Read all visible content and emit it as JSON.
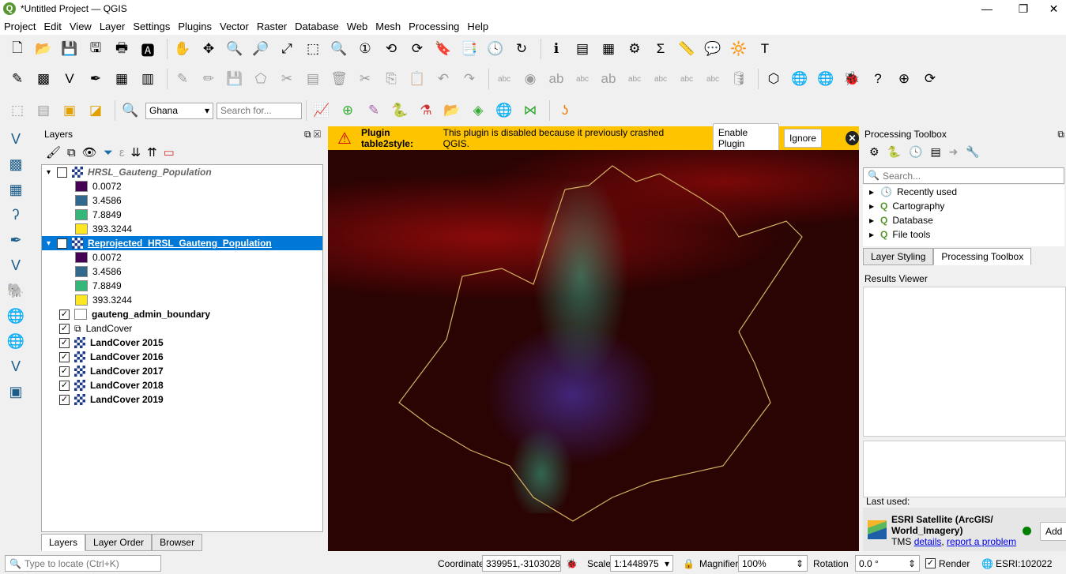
{
  "window": {
    "title": "*Untitled Project — QGIS",
    "minimize": "—",
    "maximize": "❐",
    "close": "✕"
  },
  "menu": [
    "Project",
    "Edit",
    "View",
    "Layer",
    "Settings",
    "Plugins",
    "Vector",
    "Raster",
    "Database",
    "Web",
    "Mesh",
    "Processing",
    "Help"
  ],
  "toolbar3": {
    "locator_value": "Ghana",
    "search_placeholder": "Search for..."
  },
  "layers_panel": {
    "title": "Layers",
    "layers": [
      {
        "name": "HRSL_Gauteng_Population",
        "checked": false,
        "italic": true,
        "legend": [
          {
            "label": "0.0072",
            "color": "#440154"
          },
          {
            "label": "3.4586",
            "color": "#31688e"
          },
          {
            "label": "7.8849",
            "color": "#35b779"
          },
          {
            "label": "393.3244",
            "color": "#fde725"
          }
        ]
      },
      {
        "name": "Reprojected_HRSL_Gauteng_Population",
        "checked": true,
        "selected": true,
        "legend": [
          {
            "label": "0.0072",
            "color": "#440154"
          },
          {
            "label": "3.4586",
            "color": "#31688e"
          },
          {
            "label": "7.8849",
            "color": "#35b779"
          },
          {
            "label": "393.3244",
            "color": "#fde725"
          }
        ]
      },
      {
        "name": "gauteng_admin_boundary",
        "checked": true,
        "bold": true
      },
      {
        "name": "LandCover",
        "checked": true,
        "group": true
      },
      {
        "name": "LandCover 2015",
        "checked": true,
        "bold": true
      },
      {
        "name": "LandCover 2016",
        "checked": true,
        "bold": true
      },
      {
        "name": "LandCover 2017",
        "checked": true,
        "bold": true
      },
      {
        "name": "LandCover 2018",
        "checked": true,
        "bold": true
      },
      {
        "name": "LandCover 2019",
        "checked": true,
        "bold": true
      }
    ],
    "tabs": [
      "Layers",
      "Layer Order",
      "Browser"
    ]
  },
  "message": {
    "title": "Plugin table2style:",
    "text": "This plugin is disabled because it previously crashed QGIS.",
    "enable": "Enable Plugin",
    "ignore": "Ignore"
  },
  "processing": {
    "title": "Processing Toolbox",
    "search_placeholder": "Search...",
    "items": [
      "Recently used",
      "Cartography",
      "Database",
      "File tools"
    ],
    "tabs": [
      "Layer Styling",
      "Processing Toolbox"
    ]
  },
  "results": {
    "title": "Results Viewer"
  },
  "qms": {
    "last_used": "Last used:",
    "service_name": "ESRI Satellite (ArcGIS/ World_Imagery)",
    "type": "TMS",
    "details": "details",
    "report": "report a problem",
    "add": "Add",
    "status_color": "#008000"
  },
  "status": {
    "locate_placeholder": "Type to locate (Ctrl+K)",
    "coordinate_label": "Coordinate",
    "coordinate": "339951,-3103028",
    "scale_label": "Scale",
    "scale": "1:1448975",
    "magnifier_label": "Magnifier",
    "magnifier": "100%",
    "rotation_label": "Rotation",
    "rotation": "0.0 °",
    "render_label": "Render",
    "render": true,
    "crs": "ESRI:102022"
  }
}
